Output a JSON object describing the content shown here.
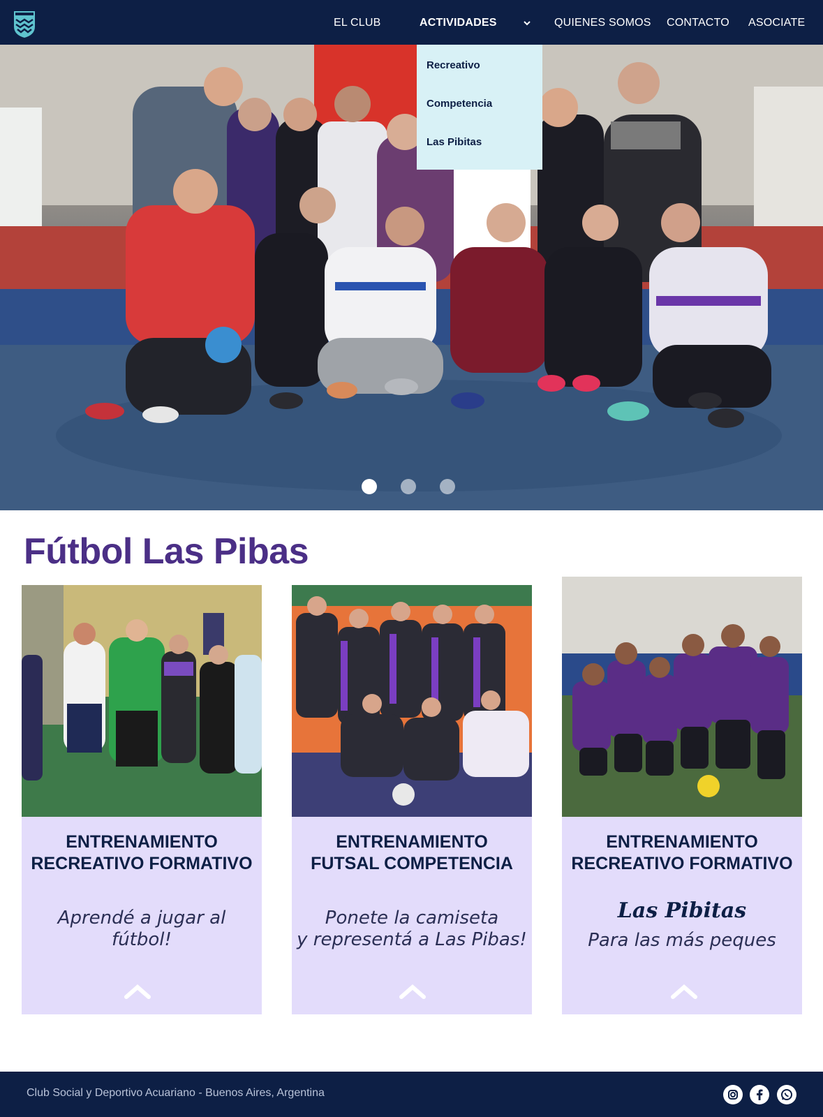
{
  "nav": {
    "items": [
      {
        "label": "EL CLUB"
      },
      {
        "label": "ACTIVIDADES"
      },
      {
        "label": "QUIENES SOMOS"
      },
      {
        "label": "CONTACTO"
      },
      {
        "label": "ASOCIATE"
      }
    ],
    "active": "ACTIVIDADES",
    "dropdown": [
      "Recreativo",
      "Competencia",
      "Las Pibitas"
    ],
    "logo_icon": "wave-shield-icon"
  },
  "hero": {
    "slides": 3,
    "active_slide": 1
  },
  "section": {
    "title": "Fútbol Las Pibas"
  },
  "cards": [
    {
      "title_line1": "ENTRENAMIENTO",
      "title_line2": "RECREATIVO FORMATIVO",
      "sub_line1": "Aprendé a jugar al",
      "sub_line2": "fútbol!",
      "script": ""
    },
    {
      "title_line1": "ENTRENAMIENTO",
      "title_line2": "FUTSAL COMPETENCIA",
      "sub_line1": "Ponete la camiseta",
      "sub_line2": "y representá a Las Pibas!",
      "script": ""
    },
    {
      "title_line1": "ENTRENAMIENTO",
      "title_line2": "RECREATIVO FORMATIVO",
      "sub_line1": "Para las más peques",
      "sub_line2": "",
      "script": "Las Pibitas"
    }
  ],
  "footer": {
    "text": "Club Social y Deportivo Acuariano - Buenos Aires, Argentina",
    "social": [
      "instagram-icon",
      "facebook-icon",
      "whatsapp-icon"
    ]
  },
  "colors": {
    "navy": "#0d1f45",
    "purple": "#4b2f86",
    "lavender": "#e3dcfb",
    "dropdown": "#d8f1f6"
  }
}
